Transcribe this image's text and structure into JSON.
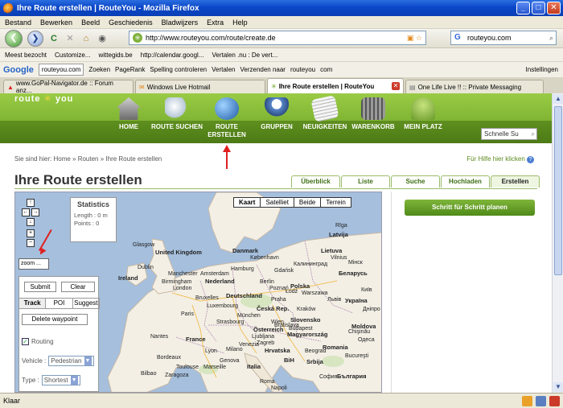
{
  "window": {
    "title": "Ihre Route erstellen | RouteYou - Mozilla Firefox"
  },
  "menu": [
    "Bestand",
    "Bewerken",
    "Beeld",
    "Geschiedenis",
    "Bladwijzers",
    "Extra",
    "Help"
  ],
  "nav": {
    "url": "http://www.routeyou.com/route/create.de",
    "search_value": "routeyou.com"
  },
  "bookmarks": [
    "Meest bezocht",
    "Customize...",
    "wittegids.be",
    "http://calendar.googl...",
    "Vertalen .nu : De vert..."
  ],
  "google_toolbar": {
    "logo": "Google",
    "search_value": "routeyou.com",
    "items": [
      "Zoeken",
      "PageRank",
      "Spelling controleren",
      "Vertalen",
      "Verzenden naar",
      "routeyou",
      "com",
      "Instellingen"
    ]
  },
  "tabs": [
    {
      "label": "www.GoPal-Navigator.de :: Forum anz...",
      "active": false
    },
    {
      "label": "Windows Live Hotmail",
      "active": false
    },
    {
      "label": "Ihre Route erstellen | RouteYou",
      "active": true
    },
    {
      "label": "One Life Live !! :: Private Messaging",
      "active": false
    }
  ],
  "site": {
    "logo_left": "route",
    "logo_right": "you",
    "nav": [
      {
        "label1": "HOME",
        "label2": ""
      },
      {
        "label1": "ROUTE SUCHEN",
        "label2": ""
      },
      {
        "label1": "ROUTE",
        "label2": "ERSTELLEN"
      },
      {
        "label1": "GRUPPEN",
        "label2": ""
      },
      {
        "label1": "NEUIGKEITEN",
        "label2": ""
      },
      {
        "label1": "WARENKORB",
        "label2": ""
      },
      {
        "label1": "MEIN PLATZ",
        "label2": ""
      }
    ],
    "quicksearch": "Schnelle Su",
    "breadcrumb": "Sie sind hier: Home » Routen » Ihre Route erstellen",
    "help": "Für Hilfe hier klicken",
    "title": "Ihre Route erstellen",
    "page_tabs": [
      "Überblick",
      "Liste",
      "Suche",
      "Hochladen",
      "Erstellen"
    ]
  },
  "map": {
    "types": [
      "Kaart",
      "Satelliet",
      "Beide",
      "Terrein"
    ],
    "statistics": {
      "title": "Statistics",
      "length": "Length : 0 m",
      "points": "Points : 0"
    },
    "zoom_label": "zoom ...",
    "submit": "Submit",
    "clear": "Clear",
    "panel_tabs": [
      "Track",
      "POI",
      "Suggest"
    ],
    "delete_waypoint": "Delete waypoint",
    "routing_label": "Routing",
    "vehicle_label": "Vehicle :",
    "vehicle_value": "Pedestrian",
    "type_label": "Type :",
    "type_value": "Shortest",
    "labels": {
      "latvia": "Latvija",
      "lietuva": "Lietuva",
      "danmark": "Danmark",
      "belarus": "Беларусь",
      "ireland": "Ireland",
      "uk": "United Kingdom",
      "nederland": "Nederland",
      "polska": "Polska",
      "deutschland": "Deutschland",
      "cz": "Česká Rep.",
      "france": "France",
      "oesterreich": "Österreich",
      "slovensko": "Slovensko",
      "magyar": "Magyarország",
      "romania": "Romania",
      "italia": "Italia",
      "hrvatska": "Hrvatska",
      "bih": "BiH",
      "srbija": "Srbija",
      "blg": "България",
      "moldova": "Moldova",
      "ukr": "Україна",
      "glasgow": "Glasgow",
      "manchester": "Manchester",
      "london": "London",
      "berlin": "Berlin",
      "warszawa": "Warszawa",
      "wien": "Wien",
      "paris": "Paris",
      "budapest": "Budapest",
      "zagreb": "Zagreb",
      "bucharest": "Bucureşti",
      "sofia": "София",
      "beograd": "Beograd",
      "minsk": "Мінск",
      "kyiv": "Київ",
      "riga": "Rīga",
      "vilnius": "Vilnius",
      "praha": "Praha",
      "munchen": "München",
      "hamburg": "Hamburg",
      "kobenhavn": "København",
      "amsterdam": "Amsterdam",
      "bruxelles": "Bruxelles",
      "luxembourg": "Luxembourg",
      "strasbourg": "Strasbourg",
      "lyon": "Lyon",
      "bordeaux": "Bordeaux",
      "nantes": "Nantes",
      "milano": "Milano",
      "roma": "Roma",
      "napoli": "Napoli",
      "bilbao": "Bilbao",
      "zaragoza": "Zaragoza",
      "dublin": "Dublin",
      "birmingham": "Birmingham",
      "kaliningrad": "Калининград",
      "gdansk": "Gdańsk",
      "krakow": "Kraków",
      "lodz": "Łódź",
      "poznan": "Poznań",
      "bratislava": "Bratislava",
      "ljubljana": "Ljubljana",
      "venezia": "Venezia",
      "genova": "Genova",
      "marseille": "Marseille",
      "toulouse": "Toulouse",
      "odessa": "Одеса",
      "chisinau": "Chişinău",
      "lviv": "Львів",
      "dnipro": "Дніпро"
    }
  },
  "right": {
    "step_button": "Schritt für Schritt planen"
  },
  "status": "Klaar"
}
